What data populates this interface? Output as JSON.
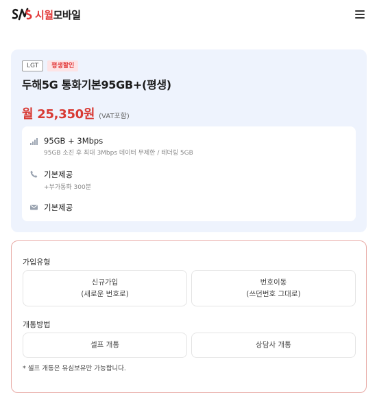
{
  "header": {
    "logo_text_accent": "시월",
    "logo_text_main": "모바일",
    "logo_icon": "sw-logo-mark",
    "menu_icon": "hamburger-icon"
  },
  "plan": {
    "carrier_badge": "LGT",
    "promo_badge": "평생할인",
    "name": "두해5G 통화기본95GB+(평생)",
    "price": "월 25,350원",
    "vat_note": "(VAT포함)",
    "features": [
      {
        "icon": "signal-bars-icon",
        "title": "95GB + 3Mbps",
        "sub": "95GB 소진 후 최대 3Mbps 데이터 무제한 / 테더링 5GB"
      },
      {
        "icon": "phone-icon",
        "title": "기본제공",
        "sub": "+부가통화 300분"
      },
      {
        "icon": "mail-icon",
        "title": "기본제공",
        "sub": ""
      }
    ]
  },
  "options": {
    "join_type_label": "가입유형",
    "join_types": [
      {
        "line1": "신규가입",
        "line2": "(새로운 번호로)"
      },
      {
        "line1": "번호이동",
        "line2": "(쓰던번호 그대로)"
      }
    ],
    "activation_label": "개통방법",
    "activation_methods": [
      {
        "label": "셀프 개통"
      },
      {
        "label": "상담사 개통"
      }
    ],
    "note": "* 셀프 개통은 유심보유만 가능합니다."
  },
  "colors": {
    "accent_red": "#d83a34",
    "card_bg": "#eef3fd",
    "option_border": "#e8a9a4"
  }
}
